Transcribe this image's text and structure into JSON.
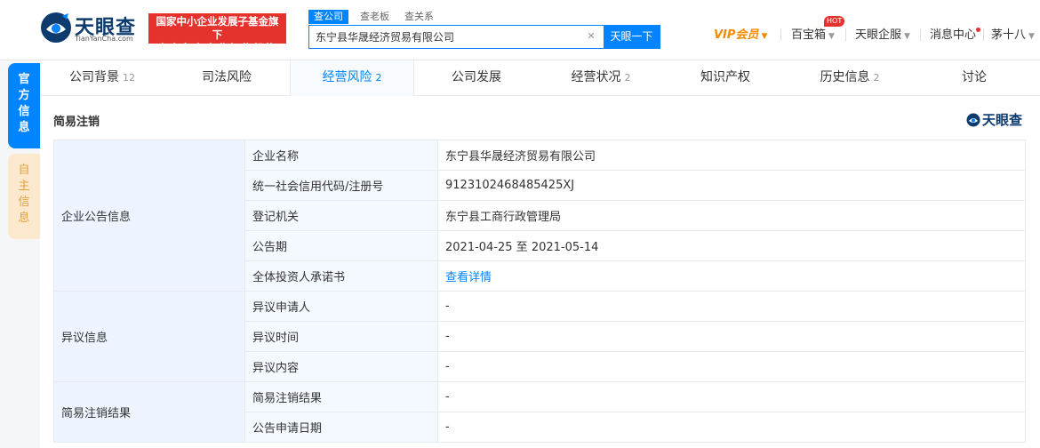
{
  "header": {
    "logo_text": "天眼查",
    "logo_sub": "TianYanCha.com",
    "badge_line1": "国家中小企业发展子基金旗下",
    "badge_line2": "官方备案企业征信机构",
    "search_tabs": [
      "查公司",
      "查老板",
      "查关系"
    ],
    "search_value": "东宁县华晟经济贸易有限公司",
    "search_button": "天眼一下",
    "nav_vip": "VIP会员",
    "nav_treasure": "百宝箱",
    "nav_hot": "HOT",
    "nav_enterprise": "天眼企服",
    "nav_messages": "消息中心",
    "nav_user": "茅十八"
  },
  "side_tabs": [
    "官方信息",
    "自主信息"
  ],
  "tabs": [
    {
      "label": "公司背景",
      "count": "12"
    },
    {
      "label": "司法风险",
      "count": ""
    },
    {
      "label": "经营风险",
      "count": "2"
    },
    {
      "label": "公司发展",
      "count": ""
    },
    {
      "label": "经营状况",
      "count": "2"
    },
    {
      "label": "知识产权",
      "count": ""
    },
    {
      "label": "历史信息",
      "count": "2"
    },
    {
      "label": "讨论",
      "count": ""
    }
  ],
  "section": {
    "title": "简易注销",
    "watermark": "天眼查"
  },
  "table": {
    "group1": "企业公告信息",
    "group2": "异议信息",
    "group3": "简易注销结果",
    "rows": [
      {
        "label": "企业名称",
        "value": "东宁县华晟经济贸易有限公司"
      },
      {
        "label": "统一社会信用代码/注册号",
        "value": "9123102468485425XJ"
      },
      {
        "label": "登记机关",
        "value": "东宁县工商行政管理局"
      },
      {
        "label": "公告期",
        "value": "2021-04-25 至 2021-05-14"
      },
      {
        "label": "全体投资人承诺书",
        "value": "查看详情"
      },
      {
        "label": "异议申请人",
        "value": "-"
      },
      {
        "label": "异议时间",
        "value": "-"
      },
      {
        "label": "异议内容",
        "value": "-"
      },
      {
        "label": "简易注销结果",
        "value": "-"
      },
      {
        "label": "公告申请日期",
        "value": "-"
      }
    ]
  },
  "colors": {
    "brand_blue": "#0084ff",
    "logo_navy": "#0d3b6e",
    "badge_red": "#e5322d",
    "vip_orange": "#f28b00"
  }
}
